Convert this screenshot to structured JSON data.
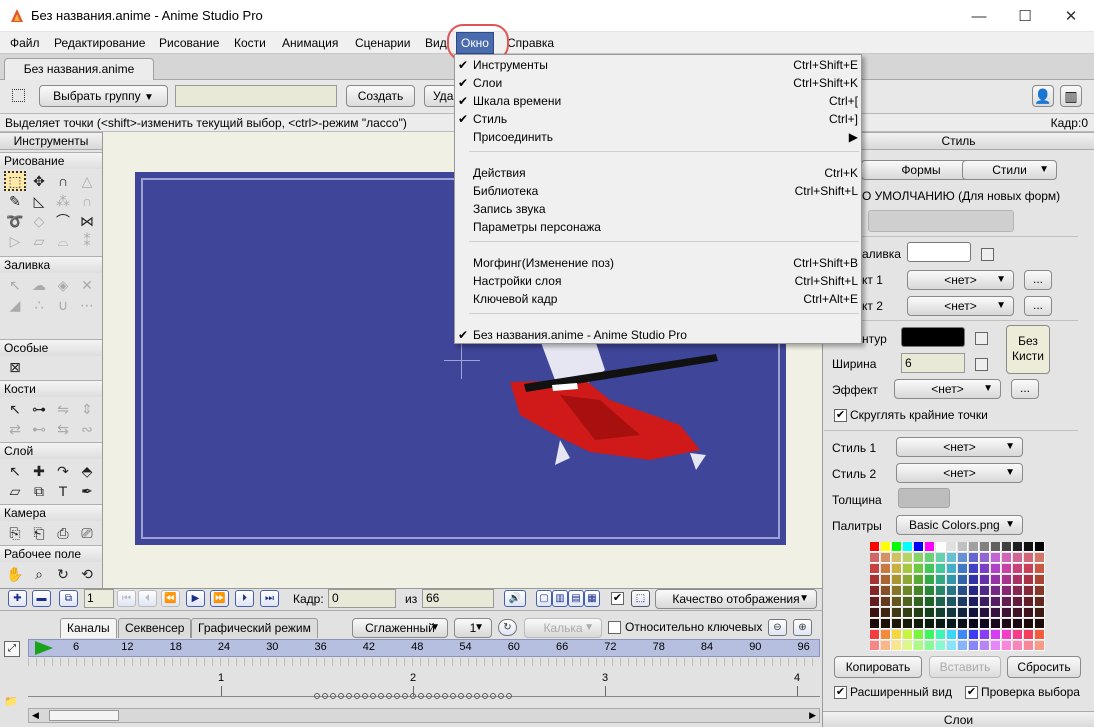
{
  "window": {
    "title": "Без названия.anime - Anime Studio Pro",
    "minimize": "—",
    "maximize": "☐",
    "close": "✕"
  },
  "menubar": {
    "items": [
      "Файл",
      "Редактирование",
      "Рисование",
      "Кости",
      "Анимация",
      "Сценарии",
      "Вид",
      "Окно",
      "Справка"
    ],
    "active": "Окно"
  },
  "doc_tab": "Без названия.anime",
  "toolbar": {
    "select_group": "Выбрать группу",
    "create": "Создать",
    "delete_partial": "Уда"
  },
  "status": "Выделяет точки (<shift>-изменить текущий выбор, <ctrl>-режим \"лассо\")",
  "frame_status": "Кадр:0",
  "tools_panel": {
    "title": "Инструменты",
    "sections": [
      "Рисование",
      "Заливка",
      "Особые",
      "Кости",
      "Слой",
      "Камера",
      "Рабочее поле"
    ]
  },
  "window_menu": {
    "items": [
      {
        "label": "Инструменты",
        "shortcut": "Ctrl+Shift+E",
        "checked": "✔"
      },
      {
        "label": "Слои",
        "shortcut": "Ctrl+Shift+K",
        "checked": "✔"
      },
      {
        "label": "Шкала времени",
        "shortcut": "Ctrl+[",
        "checked": "✔"
      },
      {
        "label": "Стиль",
        "shortcut": "Ctrl+]",
        "checked": "✔"
      },
      {
        "label": "Присоединить",
        "shortcut": "▶",
        "checked": ""
      },
      {
        "label": "Действия",
        "shortcut": "Ctrl+K",
        "checked": ""
      },
      {
        "label": "Библиотека",
        "shortcut": "Ctrl+Shift+L",
        "checked": ""
      },
      {
        "label": "Запись звука",
        "shortcut": "",
        "checked": ""
      },
      {
        "label": "Параметры персонажа",
        "shortcut": "",
        "checked": ""
      },
      {
        "label": "Могфинг(Изменение поз)",
        "shortcut": "Ctrl+Shift+B",
        "checked": ""
      },
      {
        "label": "Настройки слоя",
        "shortcut": "Ctrl+Shift+L",
        "checked": ""
      },
      {
        "label": "Ключевой кадр",
        "shortcut": "Ctrl+Alt+E",
        "checked": ""
      },
      {
        "label": "Без названия.anime - Anime Studio Pro",
        "shortcut": "",
        "checked": "✔"
      }
    ]
  },
  "style_panel": {
    "title": "Стиль",
    "shapes": "Формы",
    "styles": "Стили",
    "default_label": "О УМОЛЧАНИЮ (Для новых форм)",
    "fill_label": "аливка",
    "effect1_label": "кт 1",
    "effect2_label": "кт 2",
    "outline_label": "нтур",
    "width_label": "Ширина",
    "width_value": "6",
    "effect_label": "Эффект",
    "none": "<нет>",
    "no_brush": "Без Кисти",
    "round_caps": "Скруглять крайние точки",
    "style1": "Стиль 1",
    "style2": "Стиль 2",
    "thickness": "Толщина",
    "palettes": "Палитры",
    "palette_value": "Basic Colors.png",
    "copy": "Копировать",
    "paste": "Вставить",
    "reset": "Сбросить",
    "extended_view": "Расширенный вид",
    "check_selection": "Проверка выбора",
    "layers_title": "Слои",
    "browse": "..."
  },
  "timeline": {
    "current_frame": "1",
    "frame_label": "Кадр:",
    "frame_value": "0",
    "of_label": "из",
    "total": "66",
    "quality": "Качество отображения",
    "tabs": [
      "Каналы",
      "Секвенсер",
      "Графический режим"
    ],
    "smooth": "Сглаженный",
    "one": "1",
    "onion": "Калька",
    "relative_keys": "Относительно ключевых",
    "ticks": [
      "6",
      "12",
      "18",
      "24",
      "30",
      "36",
      "42",
      "48",
      "54",
      "60",
      "66",
      "72",
      "78",
      "84",
      "90",
      "96"
    ],
    "seconds": [
      "1",
      "2",
      "3",
      "4"
    ]
  },
  "colors": {
    "stage": "#3f4598",
    "menu_active": "#4a6cae",
    "ring": "#e05555"
  }
}
